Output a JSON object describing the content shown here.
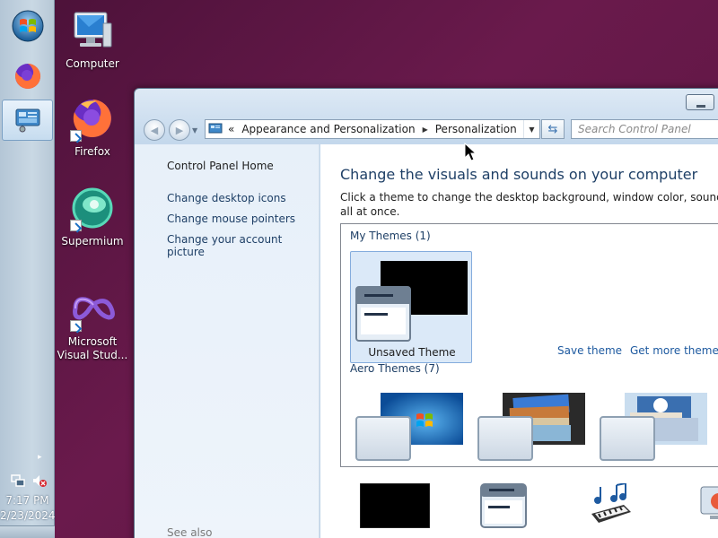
{
  "taskbar": {
    "clock_time": "7:17 PM",
    "clock_date": "2/23/2024",
    "tray_arrow": "▸"
  },
  "desktop": {
    "icons": [
      {
        "label": "Computer"
      },
      {
        "label": "Firefox"
      },
      {
        "label": "Supermium"
      },
      {
        "label": "Microsoft Visual Stud..."
      }
    ]
  },
  "window": {
    "breadcrumb": {
      "prefix": "«",
      "items": [
        "Appearance and Personalization",
        "Personalization"
      ]
    },
    "search": {
      "placeholder": "Search Control Panel"
    },
    "left_pane": {
      "home": "Control Panel Home",
      "links": [
        "Change desktop icons",
        "Change mouse pointers",
        "Change your account picture"
      ],
      "see_also": "See also"
    },
    "main": {
      "title": "Change the visuals and sounds on your computer",
      "description_line1": "Click a theme to change the desktop background, window color, sounds, and sc",
      "description_line2": "all at once.",
      "my_themes_label": "My Themes (1)",
      "unsaved_theme": "Unsaved Theme",
      "save_theme": "Save theme",
      "get_more_themes": "Get more themes o",
      "aero_themes_label": "Aero Themes (7)"
    }
  },
  "colors": {
    "desktop_bg": "#5a1540",
    "link": "#1e5aa0",
    "heading": "#1e3f66",
    "selected_tile": "#dbe9f8"
  }
}
